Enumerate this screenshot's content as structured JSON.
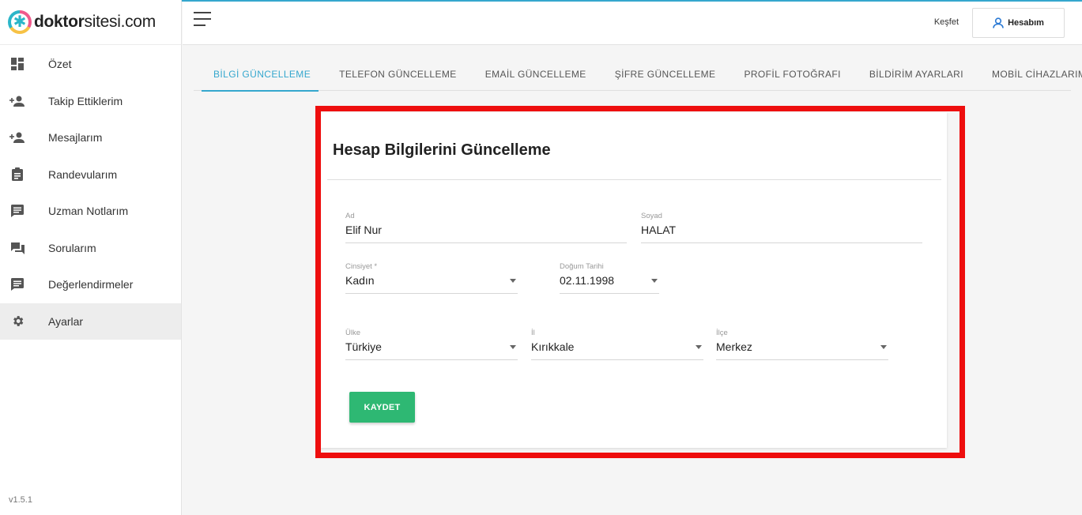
{
  "brand": {
    "name_bold": "doktor",
    "name_rest": "sitesi.com"
  },
  "sidebar": {
    "items": [
      {
        "label": "Özet",
        "icon": "dashboard-icon"
      },
      {
        "label": "Takip Ettiklerim",
        "icon": "person-add-icon"
      },
      {
        "label": "Mesajlarım",
        "icon": "person-add-icon"
      },
      {
        "label": "Randevularım",
        "icon": "clipboard-icon"
      },
      {
        "label": "Uzman Notlarım",
        "icon": "comment-icon"
      },
      {
        "label": "Sorularım",
        "icon": "forum-icon"
      },
      {
        "label": "Değerlendirmeler",
        "icon": "comment-icon"
      },
      {
        "label": "Ayarlar",
        "icon": "gear-icon",
        "active": true
      }
    ],
    "version": "v1.5.1"
  },
  "header": {
    "explore": "Keşfet",
    "account": "Hesabım"
  },
  "tabs": [
    {
      "label": "BİLGİ GÜNCELLEME",
      "active": true
    },
    {
      "label": "TELEFON GÜNCELLEME"
    },
    {
      "label": "EMAİL GÜNCELLEME"
    },
    {
      "label": "ŞİFRE GÜNCELLEME"
    },
    {
      "label": "PROFİL FOTOĞRAFI"
    },
    {
      "label": "BİLDİRİM AYARLARI"
    },
    {
      "label": "MOBİL CİHAZLARIM"
    }
  ],
  "form": {
    "title": "Hesap Bilgilerini Güncelleme",
    "ad": {
      "label": "Ad",
      "value": "Elif Nur"
    },
    "soyad": {
      "label": "Soyad",
      "value": "HALAT"
    },
    "cinsiyet": {
      "label": "Cinsiyet *",
      "value": "Kadın"
    },
    "dogum": {
      "label": "Doğum Tarihi",
      "value": "02.11.1998"
    },
    "ulke": {
      "label": "Ülke",
      "value": "Türkiye"
    },
    "il": {
      "label": "İl",
      "value": "Kırıkkale"
    },
    "ilce": {
      "label": "İlçe",
      "value": "Merkez"
    },
    "save": "KAYDET"
  },
  "colors": {
    "accent": "#35a7ce",
    "save": "#2eb873",
    "highlight": "#ee0e0e"
  }
}
